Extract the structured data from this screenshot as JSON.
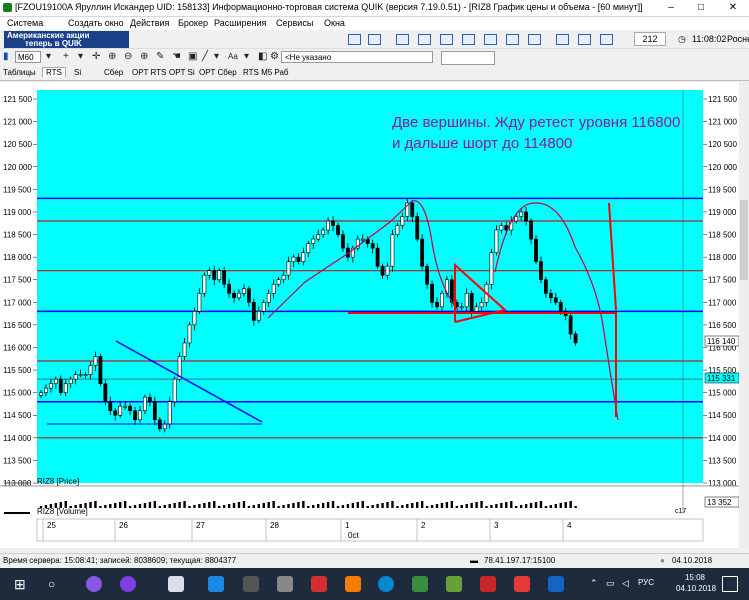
{
  "window": {
    "title": "[FZOU19100A Яруллин Искандер UID: 158133] Информационно-торговая система QUIK (версия 7.19.0.51) - [RIZ8 График цены и объема - [60 минут]]",
    "controls": [
      "–",
      "□",
      "✕"
    ]
  },
  "menu": {
    "items": [
      "Система",
      "Создать окно",
      "Действия",
      "Брокер",
      "Расширения",
      "Сервисы",
      "Окна"
    ]
  },
  "toolbar": {
    "banner_line1": "Американские акции",
    "banner_line2": "теперь в QUIK",
    "counter": "212",
    "clock": "11:08:02",
    "ticker": "Роснефт"
  },
  "toolbar2": {
    "timeframe": "M60",
    "instrument": "<Не указано"
  },
  "tabs": [
    {
      "label": "Таблицы",
      "active": false
    },
    {
      "label": "RTS",
      "active": true
    },
    {
      "label": "Si",
      "active": false
    },
    {
      "label": "Сбер",
      "active": false
    },
    {
      "label": "OPT RTS",
      "active": false
    },
    {
      "label": "OPT Si",
      "active": false
    },
    {
      "label": "OPT Сбер",
      "active": false
    },
    {
      "label": "RTS M5 Раб",
      "active": false
    }
  ],
  "chart": {
    "background": "#00ffff",
    "annotation_line1": "Две вершины.  Жду ретест уровня 116800",
    "annotation_line2": "и дальше шорт до 114800",
    "price_labels": [
      "121 500",
      "121 000",
      "120 500",
      "120 000",
      "119 500",
      "119 000",
      "118 500",
      "118 000",
      "117 500",
      "117 000",
      "116 500",
      "116 000",
      "115 500",
      "115 000",
      "114 500",
      "114 000",
      "113 500",
      "113 000"
    ],
    "current_price_tag": "116 140",
    "level_tag": "115 331",
    "volume_tag": "13 352",
    "volume_tag_small": "с17",
    "price_panel_label": "RIZ8 [Price]",
    "volume_panel_label": "RIZ8 [Volume]",
    "date_labels": [
      "25",
      "26",
      "27",
      "28",
      "1",
      "2",
      "3",
      "4"
    ],
    "month_label": "0ct"
  },
  "chart_data": {
    "type": "candlestick",
    "y_unit": "price",
    "ylim": [
      113000,
      121700
    ],
    "horizontal_levels_blue": [
      119300,
      116800,
      114800,
      115300
    ],
    "horizontal_levels_red": [
      118800,
      117700,
      115700,
      114000
    ],
    "closes": [
      115000,
      115100,
      115200,
      115300,
      115000,
      115200,
      115300,
      115400,
      115400,
      115400,
      115600,
      115800,
      115200,
      114800,
      114600,
      114500,
      114700,
      114700,
      114600,
      114400,
      114600,
      114900,
      114800,
      114400,
      114200,
      114300,
      114800,
      115300,
      115800,
      116100,
      116500,
      116800,
      117200,
      117600,
      117700,
      117500,
      117700,
      117400,
      117200,
      117100,
      117200,
      117300,
      117000,
      116600,
      116800,
      117000,
      117200,
      117400,
      117500,
      117600,
      117900,
      118000,
      117900,
      118100,
      118300,
      118400,
      118500,
      118600,
      118800,
      118700,
      118500,
      118200,
      118000,
      118200,
      118400,
      118400,
      118300,
      118200,
      117800,
      117600,
      117800,
      118500,
      118700,
      118900,
      119200,
      118900,
      118400,
      117800,
      117400,
      117000,
      116900,
      117200,
      117500,
      117000,
      116900,
      116900,
      117200,
      116800,
      116900,
      117000,
      117400,
      118100,
      118600,
      118700,
      118600,
      118800,
      118900,
      119000,
      118800,
      118400,
      117900,
      117500,
      117200,
      117100,
      117000,
      116800,
      116700,
      116300,
      116100
    ]
  },
  "status": {
    "server_time": "Время сервера: 15:08:41; записей: 8038609; текущая: 8804377",
    "ip": "78.41.197.17:15100",
    "date": "04.10.2018"
  },
  "taskbar": {
    "lang": "РУС",
    "time": "15:08",
    "date": "04.10.2018"
  }
}
